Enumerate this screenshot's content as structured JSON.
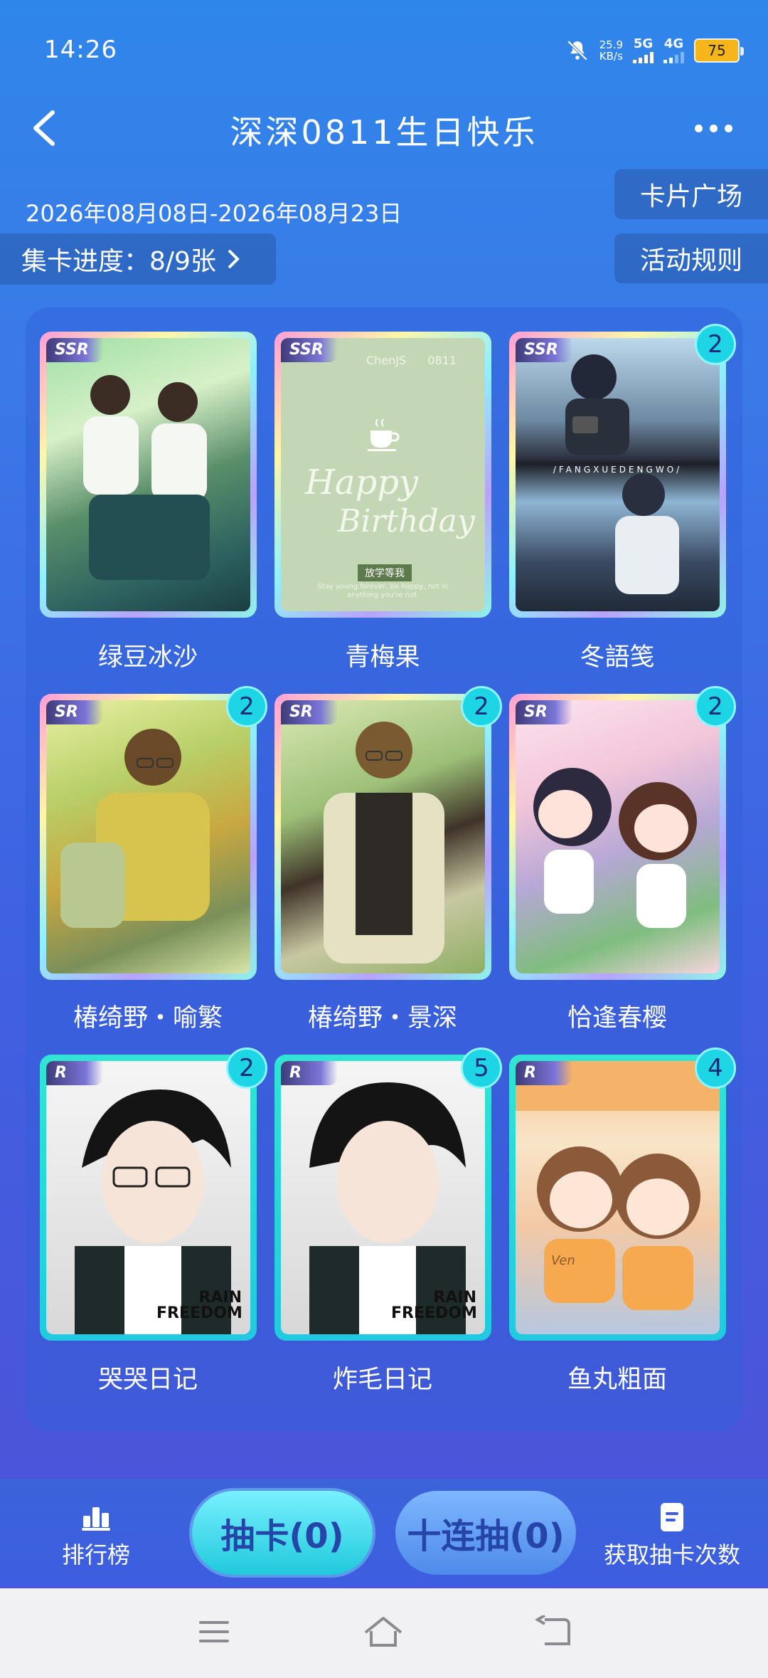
{
  "status": {
    "time": "14:26",
    "speed_value": "25.9",
    "speed_unit": "KB/s",
    "signal1": "5G",
    "signal2": "4G",
    "battery": "75"
  },
  "header": {
    "title": "深深0811生日快乐"
  },
  "event": {
    "date_range": "2026年08月08日-2026年08月23日",
    "progress_label": "集卡进度：8/9张",
    "card_square_label": "卡片广场",
    "rules_label": "活动规则"
  },
  "cards": [
    {
      "name": "绿豆冰沙",
      "rarity": "SSR",
      "count": null
    },
    {
      "name": "青梅果",
      "rarity": "SSR",
      "count": null,
      "art_texts": {
        "top_left": "ChenJS",
        "top_right": "0811",
        "script1": "Happy",
        "script2": "Birthday",
        "badge": "放学等我",
        "footer": "Stay young forever, be happy, not in anything you're not."
      }
    },
    {
      "name": "冬語笺",
      "rarity": "SSR",
      "count": "2",
      "art_texts": {
        "banner": "/FANGXUEDENGWO/"
      }
    },
    {
      "name": "椿绮野・喻繁",
      "rarity": "SR",
      "count": "2"
    },
    {
      "name": "椿绮野・景深",
      "rarity": "SR",
      "count": "2"
    },
    {
      "name": "恰逢春樱",
      "rarity": "SR",
      "count": "2"
    },
    {
      "name": "哭哭日记",
      "rarity": "R",
      "count": "2",
      "art_texts": {
        "logo": "RAIN FREEDOM"
      }
    },
    {
      "name": "炸毛日记",
      "rarity": "R",
      "count": "5",
      "art_texts": {
        "logo": "RAIN FREEDOM"
      }
    },
    {
      "name": "鱼丸粗面",
      "rarity": "R",
      "count": "4",
      "art_texts": {
        "sign": "Ven"
      }
    }
  ],
  "bottom_nav": {
    "leaderboard_label": "排行榜",
    "draw_label": "抽卡(0)",
    "ten_draw_label": "十连抽(0)",
    "get_draws_label": "获取抽卡次数"
  }
}
